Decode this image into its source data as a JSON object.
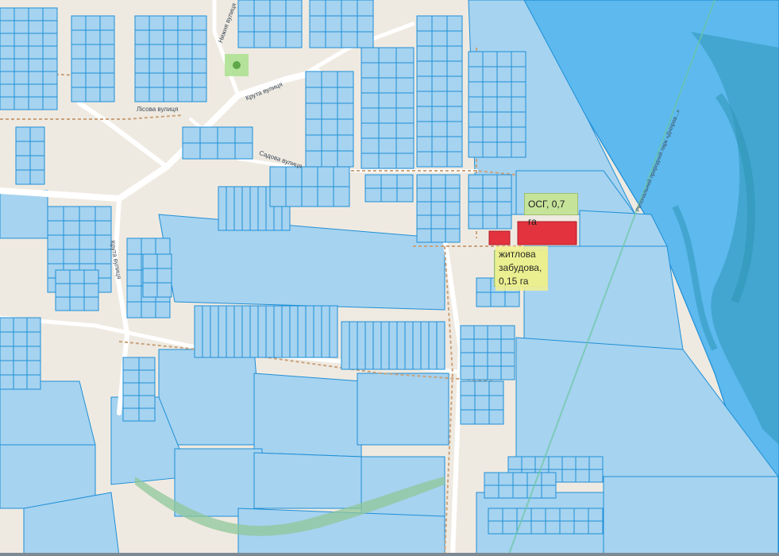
{
  "map": {
    "colors": {
      "background": "#efeae1",
      "parcel_fill": "#a6d3f0",
      "parcel_stroke": "#1f8fd6",
      "road": "#ffffff",
      "path": "#c9a27c",
      "water": "#6ec0ef",
      "park_pattern": "#2e98b8",
      "highlight": "#e2333e",
      "forest_strip": "#8fc79a"
    },
    "icons": [
      "park-icon"
    ]
  },
  "callouts": {
    "osg": {
      "text": "ОСГ, 0,7 га"
    },
    "housing": {
      "lines": [
        "житлова",
        "забудова,",
        "0,15 га"
      ]
    }
  },
  "street_labels": {
    "kruta": "Крута вулиця",
    "lisova": "Лісова вулиця",
    "sadova": "Садова вулиця",
    "kruta_2": "Крута вулиця",
    "nyzhnia": "Нижня вулиця",
    "park": "Регіональний природний парк «Дніпров...»"
  }
}
